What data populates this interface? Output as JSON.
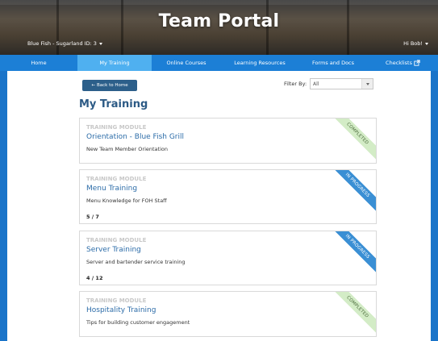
{
  "header": {
    "title": "Team Portal",
    "store_selector": "Blue Fish - Sugarland ID: 3",
    "user_greeting": "Hi Bob!"
  },
  "nav": {
    "items": [
      {
        "label": "Home"
      },
      {
        "label": "My Training",
        "active": true
      },
      {
        "label": "Online Courses"
      },
      {
        "label": "Learning Resources"
      },
      {
        "label": "Forms and Docs"
      },
      {
        "label": "Checklists",
        "icon": "external-link-icon"
      }
    ]
  },
  "main": {
    "back_button": "Back to Home",
    "back_icon": "arrow-left-icon",
    "filter_label": "Filter By:",
    "filter_value": "All",
    "page_title": "My Training",
    "modules": [
      {
        "kicker": "TRAINING MODULE",
        "name": "Orientation - Blue Fish Grill",
        "description": "New Team Member Orientation",
        "progress": "",
        "status": "COMPLETED"
      },
      {
        "kicker": "TRAINING MODULE",
        "name": "Menu Training",
        "description": "Menu Knowledge for FOH Staff",
        "progress": "5 / 7",
        "status": "IN PROGRESS"
      },
      {
        "kicker": "TRAINING MODULE",
        "name": "Server Training",
        "description": "Server and bartender service training",
        "progress": "4 / 12",
        "status": "IN PROGRESS"
      },
      {
        "kicker": "TRAINING MODULE",
        "name": "Hospitality Training",
        "description": "Tips for building customer engagement",
        "progress": "",
        "status": "COMPLETED"
      }
    ]
  },
  "colors": {
    "frame_blue": "#1a74c9",
    "nav_blue": "#1c7fd6",
    "nav_active": "#4fb0f0",
    "title_blue": "#2c5a85",
    "link_blue": "#2c6ca8",
    "ribbon_completed": "#d3ecc6",
    "ribbon_in_progress": "#3a8fd4"
  }
}
